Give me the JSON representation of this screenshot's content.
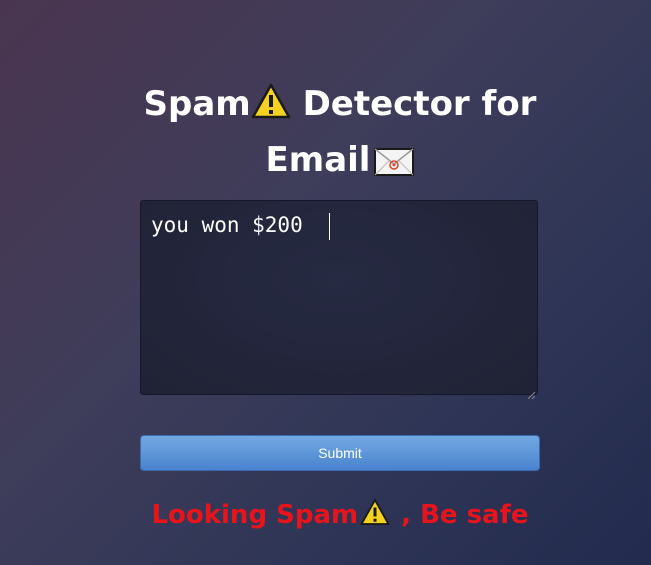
{
  "title": {
    "line1_before_icon": "Spam",
    "line1_after_icon": " Detector for",
    "line2": "Email",
    "warning_icon": "warning-icon",
    "mail_icon": "envelope-icon"
  },
  "email_input": {
    "value": "you won $200 "
  },
  "submit_button": {
    "label": "Submit"
  },
  "result": {
    "before_icon": "Looking Spam",
    "after_icon": " , Be safe",
    "color": "#e8141c"
  },
  "colors": {
    "button": "#5b94d8",
    "background": "#34365a"
  }
}
